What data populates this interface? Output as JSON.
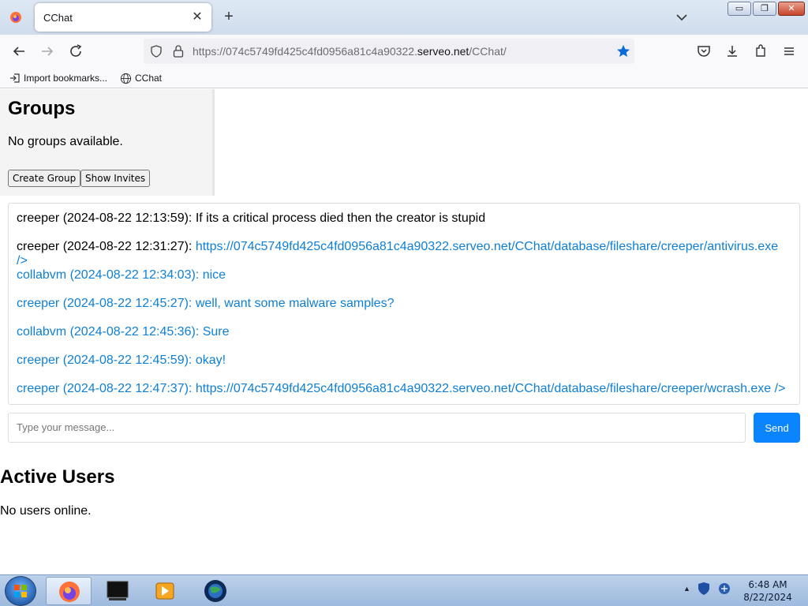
{
  "browser": {
    "tab_title": "CChat",
    "tab_close": "✕",
    "new_tab": "+",
    "url_prefix": "https://074c5749fd425c4fd0956a81c4a90322.",
    "url_domain": "serveo.net",
    "url_path": "/CChat/",
    "accent_color": "#0a84ff",
    "bookmarks": [
      {
        "label": "Import bookmarks...",
        "icon": "import-icon"
      },
      {
        "label": "CChat",
        "icon": "globe-icon"
      }
    ]
  },
  "groups": {
    "title": "Groups",
    "empty_text": "No groups available.",
    "create_label": "Create Group",
    "invites_label": "Show Invites"
  },
  "chat": {
    "messages": [
      {
        "text": "creeper (2024-08-22 12:13:59): If its a critical process died then the creator is stupid"
      },
      {
        "prefix": "creeper (2024-08-22 12:31:27): ",
        "link": "https://074c5749fd425c4fd0956a81c4a90322.serveo.net/CChat/database/fileshare/creeper/antivirus.exe",
        "tail": "/>"
      },
      {
        "text": "collabvm (2024-08-22 12:34:03): nice"
      },
      {
        "text": "creeper (2024-08-22 12:45:27): well, want some malware samples?"
      },
      {
        "text": "collabvm (2024-08-22 12:45:36): Sure"
      },
      {
        "text": "creeper (2024-08-22 12:45:59): okay!"
      },
      {
        "text": "creeper (2024-08-22 12:47:37): https://074c5749fd425c4fd0956a81c4a90322.serveo.net/CChat/database/fileshare/creeper/wcrash.exe />"
      }
    ],
    "input_placeholder": "Type your message...",
    "send_label": "Send"
  },
  "users": {
    "title": "Active Users",
    "empty_text": "No users online."
  },
  "taskbar": {
    "time": "6:48 AM",
    "date": "8/22/2024"
  }
}
